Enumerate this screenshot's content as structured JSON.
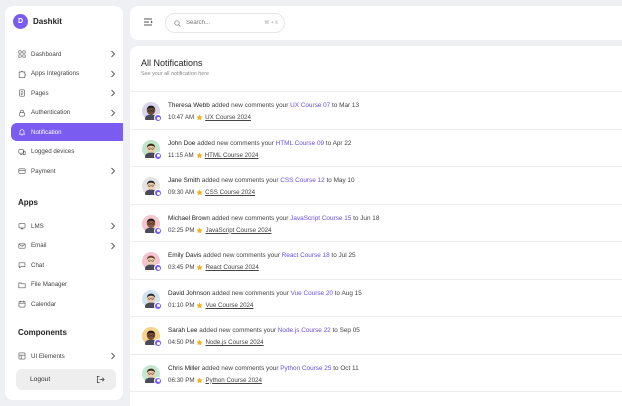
{
  "brand": {
    "name": "Dashkit",
    "logo_letter": "D"
  },
  "colors": {
    "accent": "#7b5cf0",
    "link": "#6b4ee6",
    "star": "#f2b01e"
  },
  "nav": [
    {
      "label": "Dashboard",
      "icon": "grid-icon",
      "chevron": true,
      "active": false
    },
    {
      "label": "Apps Integrations",
      "icon": "puzzle-icon",
      "chevron": true,
      "active": false
    },
    {
      "label": "Pages",
      "icon": "pages-icon",
      "chevron": true,
      "active": false
    },
    {
      "label": "Authentication",
      "icon": "lock-icon",
      "chevron": true,
      "active": false
    },
    {
      "label": "Notification",
      "icon": "bell-icon",
      "chevron": false,
      "active": true
    },
    {
      "label": "Logged devices",
      "icon": "devices-icon",
      "chevron": false,
      "active": false
    },
    {
      "label": "Payment",
      "icon": "card-icon",
      "chevron": true,
      "active": false
    }
  ],
  "apps_title": "Apps",
  "apps": [
    {
      "label": "LMS",
      "icon": "lms-icon",
      "chevron": true
    },
    {
      "label": "Email",
      "icon": "mail-icon",
      "chevron": true
    },
    {
      "label": "Chat",
      "icon": "chat-icon",
      "chevron": false
    },
    {
      "label": "File Manager",
      "icon": "folder-icon",
      "chevron": false
    },
    {
      "label": "Calendar",
      "icon": "calendar-icon",
      "chevron": false
    }
  ],
  "components_title": "Components",
  "components": [
    {
      "label": "UI Elements",
      "icon": "elements-icon",
      "chevron": true
    }
  ],
  "logout_label": "Logout",
  "search": {
    "placeholder": "Search...",
    "shortcut": "⌘ + k"
  },
  "page": {
    "title": "All Notifications",
    "subtitle": "See your all notification here"
  },
  "notifications": [
    {
      "name": "Theresa Webb",
      "action": " added new comments your ",
      "course": "UX Course 07",
      "date_prefix": " to ",
      "date": "Mar 13",
      "time": "10:47 AM",
      "link": "UX Course 2024",
      "avatar_bg": "#d8d4ea",
      "skin": "#6b4a3a",
      "hair": "#1e1a1a"
    },
    {
      "name": "John Doe",
      "action": " added new comments your ",
      "course": "HTML Course 09",
      "date_prefix": " to ",
      "date": "Apr 22",
      "time": "11:15 AM",
      "link": "HTML Course 2024",
      "avatar_bg": "#bfe6c9",
      "skin": "#f0c8a4",
      "hair": "#3b2a20"
    },
    {
      "name": "Jane Smith",
      "action": " added new comments your ",
      "course": "CSS Course 12",
      "date_prefix": " to ",
      "date": "May 10",
      "time": "09:30 AM",
      "link": "CSS Course 2024",
      "avatar_bg": "#e4e4e4",
      "skin": "#f2ceae",
      "hair": "#2a2a2a"
    },
    {
      "name": "Michael Brown",
      "action": " added new comments your ",
      "course": "JavaScript Course 15",
      "date_prefix": " to ",
      "date": "Jun 18",
      "time": "02:25 PM",
      "link": "JavaScript Course 2024",
      "avatar_bg": "#f6c6cf",
      "skin": "#8a5a3c",
      "hair": "#1a1a1a"
    },
    {
      "name": "Emily Davis",
      "action": " added new comments your ",
      "course": "React Course 18",
      "date_prefix": " to ",
      "date": "Jul 25",
      "time": "03:45 PM",
      "link": "React Course 2024",
      "avatar_bg": "#f3c4d2",
      "skin": "#f3cfb2",
      "hair": "#6a4630"
    },
    {
      "name": "David Johnson",
      "action": " added new comments your ",
      "course": "Vue Course 20",
      "date_prefix": " to ",
      "date": "Aug 15",
      "time": "01:10 PM",
      "link": "Vue Course 2024",
      "avatar_bg": "#cfe4f4",
      "skin": "#f0c9a6",
      "hair": "#2b2b2b"
    },
    {
      "name": "Sarah Lee",
      "action": " added new comments your ",
      "course": "Node.js Course 22",
      "date_prefix": " to ",
      "date": "Sep 05",
      "time": "04:50 PM",
      "link": "Node.js Course 2024",
      "avatar_bg": "#f7d28c",
      "skin": "#7a4e36",
      "hair": "#1e1a1a"
    },
    {
      "name": "Chris Miller",
      "action": " added new comments your ",
      "course": "Python Course 25",
      "date_prefix": " to ",
      "date": "Oct 11",
      "time": "06:30 PM",
      "link": "Python Course 2024",
      "avatar_bg": "#c2e8cf",
      "skin": "#f1caa8",
      "hair": "#3a2a22"
    }
  ]
}
